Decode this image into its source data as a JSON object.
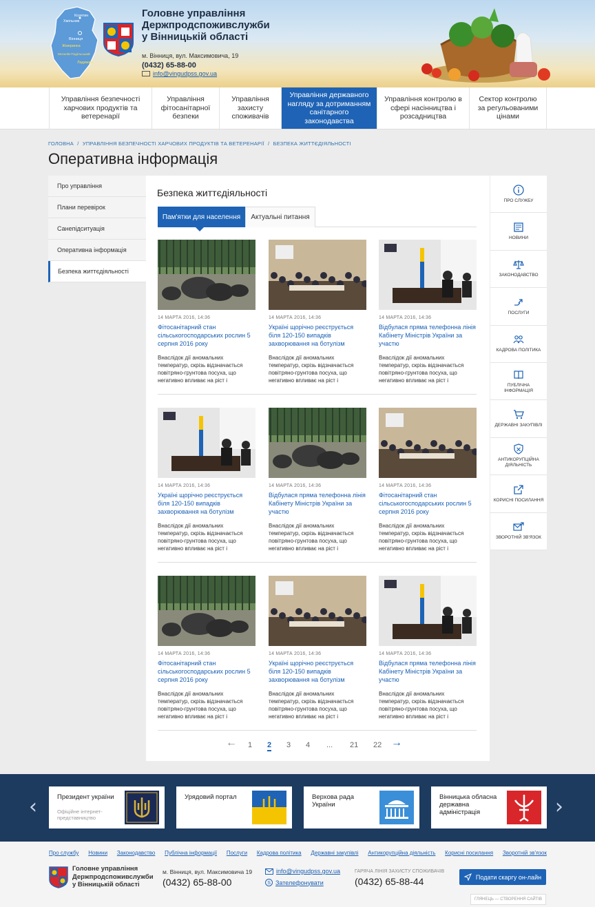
{
  "header": {
    "org_title": "Головне управління Держпродспоживслужби у Вінницькій області",
    "address": "м. Вінниця, вул. Максимовича, 19",
    "phone": "(0432) 65-88-00",
    "email": "info@vingudpss.gov.ua",
    "map_labels": [
      "Козятин",
      "Хмільник",
      "Вінниця",
      "Жмеринка",
      "Могилів-Подільський",
      "Ладижин"
    ]
  },
  "nav": [
    "Управління безпечності харчових продуктів та ветеренарії",
    "Управління фітосанітарної безпеки",
    "Управління захисту споживачів",
    "Управління державного нагляду за дотриманням санітарного законодавства",
    "Управління контролю в сфері насінництва і розсадництва",
    "Сектор контролю за регульованими цінами"
  ],
  "breadcrumb": {
    "home": "Головна",
    "section": "Управління безпечності харчових продуктів та ветеренарії",
    "current": "Безпека життєдіяльності",
    "sep": "/"
  },
  "page_title": "Оперативна інформація",
  "side_left": [
    "Про управління",
    "Плани перевірок",
    "Санепідситуація",
    "Оперативна інформація",
    "Безпека життєдіяльності"
  ],
  "section_title": "Безпека життєдіяльності",
  "tabs": [
    "Пам'ятки для населення",
    "Актуальні питання"
  ],
  "cards": [
    {
      "img": "pigs",
      "date": "14 МАРТА 2016, 14:36",
      "title": "Фітосанітарний стан сільськогосподарських рослин 5 серпня 2016 року",
      "text": "Внаслідок дії аномальних температур, скрізь відзначається повітряно-грунтова посуха, що негативно впливає на ріст і"
    },
    {
      "img": "meeting",
      "date": "14 МАРТА 2016, 14:36",
      "title": "Україні щорічно реєструється біля 120-150 випадків захворювання на ботулізм",
      "text": "Внаслідок дії аномальних температур, скрізь відзначається повітряно-грунтова посуха, що негативно впливає на ріст і"
    },
    {
      "img": "office",
      "date": "14 МАРТА 2016, 14:36",
      "title": "Відбулася пряма телефонна лінія Кабінету Міністрів України за участю",
      "text": "Внаслідок дії аномальних температур, скрізь відзначається повітряно-грунтова посуха, що негативно впливає на ріст і"
    },
    {
      "img": "office",
      "date": "14 МАРТА 2016, 14:36",
      "title": "Україні щорічно реєструється біля 120-150 випадків захворювання на ботулізм",
      "text": "Внаслідок дії аномальних температур, скрізь відзначається повітряно-грунтова посуха, що негативно впливає на ріст і"
    },
    {
      "img": "pigs",
      "date": "14 МАРТА 2016, 14:36",
      "title": "Відбулася пряма телефонна лінія Кабінету Міністрів України за участю",
      "text": "Внаслідок дії аномальних температур, скрізь відзначається повітряно-грунтова посуха, що негативно впливає на ріст і"
    },
    {
      "img": "meeting",
      "date": "14 МАРТА 2016, 14:36",
      "title": "Фітосанітарний стан сільськогосподарських рослин 5 серпня 2016 року",
      "text": "Внаслідок дії аномальних температур, скрізь відзначається повітряно-грунтова посуха, що негативно впливає на ріст і"
    },
    {
      "img": "pigs",
      "date": "14 МАРТА 2016, 14:36",
      "title": "Фітосанітарний стан сільськогосподарських рослин 5 серпня 2016 року",
      "text": "Внаслідок дії аномальних температур, скрізь відзначається повітряно-грунтова посуха, що негативно впливає на ріст і"
    },
    {
      "img": "meeting",
      "date": "14 МАРТА 2016, 14:36",
      "title": "Україні щорічно реєструється біля 120-150 випадків захворювання на ботулізм",
      "text": "Внаслідок дії аномальних температур, скрізь відзначається повітряно-грунтова посуха, що негативно впливає на ріст і"
    },
    {
      "img": "office",
      "date": "14 МАРТА 2016, 14:36",
      "title": "Відбулася пряма телефонна лінія Кабінету Міністрів України за участю",
      "text": "Внаслідок дії аномальних температур, скрізь відзначається повітряно-грунтова посуха, що негативно впливає на ріст і"
    }
  ],
  "pager": {
    "prev": "←",
    "pages": [
      "1",
      "2",
      "3",
      "4",
      "...",
      "21",
      "22"
    ],
    "current": "2",
    "next": "→"
  },
  "side_right": [
    {
      "label": "Про службу",
      "icon": "info-icon"
    },
    {
      "label": "Новини",
      "icon": "news-icon"
    },
    {
      "label": "Законодавство",
      "icon": "scales-icon"
    },
    {
      "label": "Послуги",
      "icon": "services-icon"
    },
    {
      "label": "Кадрова політика",
      "icon": "people-icon"
    },
    {
      "label": "Публічна інформація",
      "icon": "book-icon"
    },
    {
      "label": "Державні закупівлі",
      "icon": "cart-icon"
    },
    {
      "label": "Антикорупційна діяльність",
      "icon": "shield-icon"
    },
    {
      "label": "Корисні посилання",
      "icon": "external-link-icon"
    },
    {
      "label": "Зворотній зв'язок",
      "icon": "mail-arrow-icon"
    }
  ],
  "partners": [
    {
      "title": "Президент україни",
      "sub": "Офіційне інтернет-представництво",
      "icon": "trident-icon"
    },
    {
      "title": "Урядовий портал",
      "sub": "",
      "icon": "ukraine-coat-icon"
    },
    {
      "title": "Верхова рада України",
      "sub": "",
      "icon": "parliament-icon"
    },
    {
      "title": "Вінницька обласна державна адміністрація",
      "sub": "",
      "icon": "vinnytsia-coat-icon"
    }
  ],
  "footer": {
    "links": [
      "Про службу",
      "Новини",
      "Законодавство",
      "Публічна інформації",
      "Послуги",
      "Кадрова політика",
      "Державні закупівлі",
      "Антикорупційна діяльність",
      "Корисні посилання",
      "Зворотній зв'язок"
    ],
    "org": "Головне управління Держпродспоживслужби у Вінницькій області",
    "address": "м. Вінниця, вул. Максимовича 19",
    "phone": "(0432) 65-88-00",
    "email": "info@vingudpss.gov.ua",
    "call": "Зателефонувати",
    "hotline_label": "Гаряча лінія захисту споживачів",
    "hotline": "(0432) 65-88-44",
    "complaint_btn": "Подати скаргу он-лайн",
    "made_by": "Глянець — створення сайтів"
  },
  "colors": {
    "accent": "#1e63b5",
    "partners_bg": "#1d3a5f",
    "link": "#1a5fb4"
  }
}
